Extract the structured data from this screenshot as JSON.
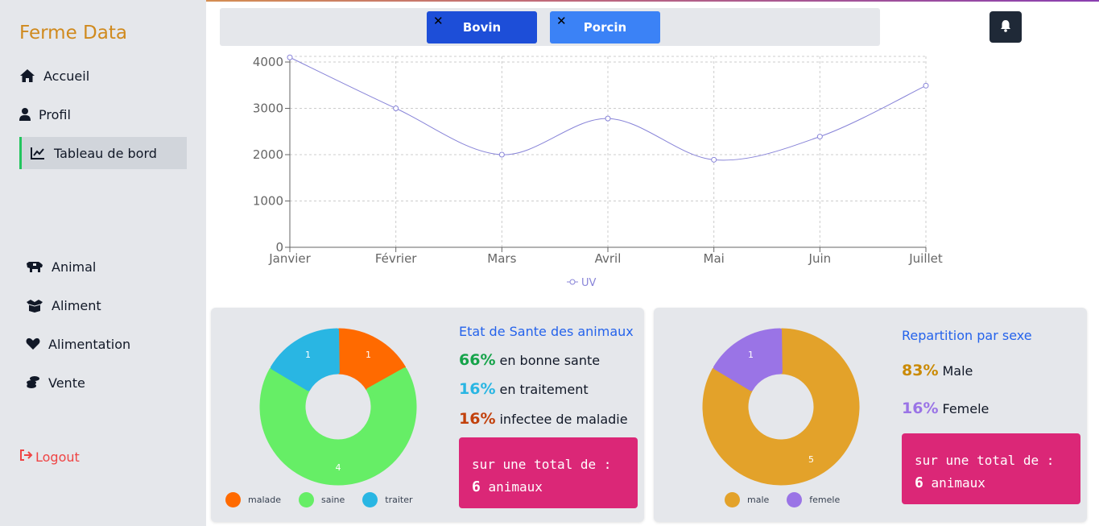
{
  "app": {
    "brand": "Ferme Data"
  },
  "sidebar": {
    "items": [
      {
        "label": "Accueil",
        "icon": "home-icon"
      },
      {
        "label": "Profil",
        "icon": "user-icon"
      },
      {
        "label": "Tableau de bord",
        "icon": "chart-line-icon",
        "active": true
      },
      {
        "label": "Animal",
        "icon": "cow-icon"
      },
      {
        "label": "Aliment",
        "icon": "box-icon"
      },
      {
        "label": "Alimentation",
        "icon": "heart-icon"
      },
      {
        "label": "Vente",
        "icon": "coins-icon"
      }
    ],
    "logout": "Logout"
  },
  "filters": [
    {
      "label": "Bovin",
      "color": "#1d4ed8",
      "remove": "✕"
    },
    {
      "label": "Porcin",
      "color": "#3b82f6",
      "remove": "✕"
    }
  ],
  "chart_data": [
    {
      "type": "line",
      "categories": [
        "Janvier",
        "Février",
        "Mars",
        "Avril",
        "Mai",
        "Juin",
        "Juillet"
      ],
      "series": [
        {
          "name": "UV",
          "values": [
            4100,
            3000,
            2000,
            2780,
            1890,
            2390,
            3490
          ],
          "color": "#8884d8"
        }
      ],
      "yticks": [
        "0",
        "1000",
        "2000",
        "3000",
        "4000"
      ],
      "ylim": [
        0,
        4000
      ],
      "grid": true,
      "legend_position": "bottom"
    },
    {
      "type": "pie",
      "title": "Etat de Sante des animaux",
      "categories": [
        "malade",
        "saine",
        "traiter"
      ],
      "values": [
        1,
        4,
        1
      ],
      "colors": [
        "#ff6a00",
        "#66ee66",
        "#29b6e3"
      ]
    },
    {
      "type": "pie",
      "title": "Repartition par sexe",
      "categories": [
        "male",
        "femele"
      ],
      "values": [
        5,
        1
      ],
      "colors": [
        "#e3a22a",
        "#9a74e6"
      ]
    }
  ],
  "health": {
    "title": "Etat de Sante des animaux",
    "stats": [
      {
        "pct": "66%",
        "text": "en bonne sante",
        "color": "#16a34a"
      },
      {
        "pct": "16%",
        "text": "en traitement",
        "color": "#29b6e3"
      },
      {
        "pct": "16%",
        "text": "infectee de maladie",
        "color": "#c2410c"
      }
    ],
    "total_prefix": "sur une total de :",
    "total_num": "6",
    "total_suffix": "animaux"
  },
  "sex": {
    "title": "Repartition par sexe",
    "stats": [
      {
        "pct": "83%",
        "text": "Male",
        "color": "#ca8a04"
      },
      {
        "pct": "16%",
        "text": "Femele",
        "color": "#9a74e6"
      }
    ],
    "total_prefix": "sur une total de :",
    "total_num": "6",
    "total_suffix": "animaux"
  }
}
